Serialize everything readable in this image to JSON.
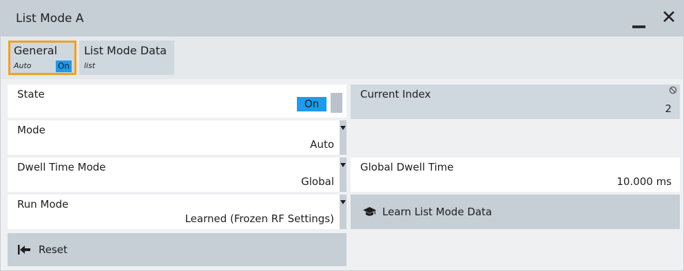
{
  "window": {
    "title": "List Mode  A",
    "minimize_icon": "minimize-icon",
    "close_icon": "close-icon",
    "close_glyph": "✕"
  },
  "tabs": [
    {
      "label": "General",
      "sub": "Auto",
      "badge": "On",
      "active": true
    },
    {
      "label": "List Mode Data",
      "sub": "list",
      "active": false
    }
  ],
  "left": {
    "state": {
      "label": "State",
      "toggle_label": "On"
    },
    "mode": {
      "label": "Mode",
      "value": "Auto"
    },
    "dwell_time_mode": {
      "label": "Dwell Time Mode",
      "value": "Global"
    },
    "run_mode": {
      "label": "Run Mode",
      "value": "Learned (Frozen RF Settings)"
    },
    "reset": {
      "label": "Reset",
      "icon": "reset-arrow-icon"
    }
  },
  "right": {
    "current_index": {
      "label": "Current Index",
      "value": "2",
      "icon": "read-only-icon"
    },
    "global_dwell_time": {
      "label": "Global Dwell Time",
      "value": "10.000 ms"
    },
    "learn": {
      "label": "Learn List Mode Data",
      "icon": "graduation-cap-icon"
    }
  },
  "colors": {
    "accent_blue": "#1e9bea",
    "focus_orange": "#f0a020",
    "titlebar": "#c6ced6",
    "button": "#c6ced6"
  }
}
